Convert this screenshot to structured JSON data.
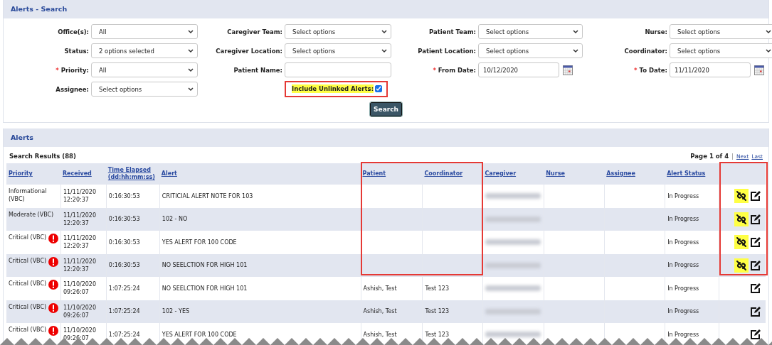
{
  "search_panel": {
    "title": "Alerts - Search",
    "fields": [
      {
        "kind": "select",
        "label": "Office(s):",
        "value": "All"
      },
      {
        "kind": "select",
        "label": "Caregiver Team:",
        "value": "Select options"
      },
      {
        "kind": "select",
        "label": "Patient Team:",
        "value": "Select options"
      },
      {
        "kind": "select",
        "label": "Nurse:",
        "value": "Select options"
      },
      {
        "kind": "select",
        "label": "Status:",
        "value": "2 options selected"
      },
      {
        "kind": "select",
        "label": "Caregiver Location:",
        "value": "Select options"
      },
      {
        "kind": "select",
        "label": "Patient Location:",
        "value": "Select options"
      },
      {
        "kind": "select",
        "label": "Coordinator:",
        "value": "Select options"
      },
      {
        "kind": "select",
        "label": "Priority:",
        "required_mark": "*",
        "value": "All"
      },
      {
        "kind": "text",
        "label": "Patient Name:"
      },
      {
        "kind": "date",
        "label": "From Date:",
        "required_mark": "*",
        "value": "10/12/2020"
      },
      {
        "kind": "date",
        "label": "To Date:",
        "required_mark": "*",
        "value": "11/11/2020"
      },
      {
        "kind": "select",
        "label": "Assignee:",
        "value": "Select options"
      },
      {
        "kind": "checkbox",
        "label": "Include Unlinked Alerts:",
        "checked": true,
        "highlighted": true,
        "annotated": true
      }
    ],
    "search_button": "Search"
  },
  "alerts_panel": {
    "title": "Alerts",
    "results": "Search Results (88)",
    "page": "Page 1 of 4",
    "separator": "|",
    "links": [
      "Next",
      "Last"
    ],
    "table": {
      "columns": [
        {
          "label": "Priority",
          "annotated": false
        },
        {
          "label": "Received",
          "annotated": false
        },
        {
          "label": "Time Elapsed",
          "sub": "(dd:hh:mm:ss)",
          "annotated": false
        },
        {
          "label": "Alert",
          "annotated": false
        },
        {
          "label": "Patient",
          "annotated": true
        },
        {
          "label": "Coordinator",
          "annotated": true
        },
        {
          "label": "Caregiver",
          "annotated": false
        },
        {
          "label": "Nurse",
          "annotated": false
        },
        {
          "label": "Assignee",
          "annotated": false
        },
        {
          "label": "Alert Status",
          "annotated": false
        },
        {
          "annotated": true
        }
      ],
      "rows": [
        {
          "priority": "Informational (VBC)",
          "critical": false,
          "received": "11/11/2020 12:20:37",
          "elapsed": "0:16:30:53",
          "alert": "CRITICIAL ALERT NOTE FOR 103",
          "caregiver_blurred": true,
          "status": "In Progress",
          "unlinked": true,
          "annotated": true
        },
        {
          "priority": "Moderate (VBC)",
          "critical": false,
          "received": "11/11/2020 12:20:37",
          "elapsed": "0:16:30:53",
          "alert": "102 - NO",
          "caregiver_blurred": true,
          "status": "In Progress",
          "unlinked": true,
          "annotated": true
        },
        {
          "priority": "Critical (VBC)",
          "critical": true,
          "received": "11/11/2020 12:20:37",
          "elapsed": "0:16:30:53",
          "alert": "YES ALERT FOR 100 CODE",
          "caregiver_blurred": true,
          "status": "In Progress",
          "unlinked": true,
          "annotated": true
        },
        {
          "priority": "Critical (VBC)",
          "critical": true,
          "received": "11/11/2020 12:20:37",
          "elapsed": "0:16:30:53",
          "alert": "NO SEELCTION FOR HIGH 101",
          "caregiver_blurred": true,
          "status": "In Progress",
          "unlinked": true,
          "annotated": true
        },
        {
          "priority": "Critical (VBC)",
          "critical": true,
          "received": "11/10/2020 09:26:07",
          "elapsed": "1:07:25:24",
          "alert": "NO SEELCTION FOR HIGH 101",
          "patient": "Ashish, Test",
          "coordinator": "Test 123",
          "caregiver_blurred": true,
          "status": "In Progress",
          "unlinked": false,
          "annotated": false
        },
        {
          "priority": "Critical (VBC)",
          "critical": true,
          "received": "11/10/2020 09:26:07",
          "elapsed": "1:07:25:24",
          "alert": "102 - YES",
          "patient": "Ashish, Test",
          "coordinator": "Test 123",
          "caregiver_blurred": true,
          "status": "In Progress",
          "unlinked": false,
          "annotated": false
        },
        {
          "priority": "Critical (VBC)",
          "critical": true,
          "received": "11/10/2020 09:26:07",
          "elapsed": "1:07:25:24",
          "alert": "YES ALERT FOR 100 CODE",
          "patient": "Ashish, Test",
          "coordinator": "Test 123",
          "caregiver_blurred": true,
          "status": "In Progress",
          "unlinked": false,
          "annotated": false
        }
      ]
    }
  }
}
